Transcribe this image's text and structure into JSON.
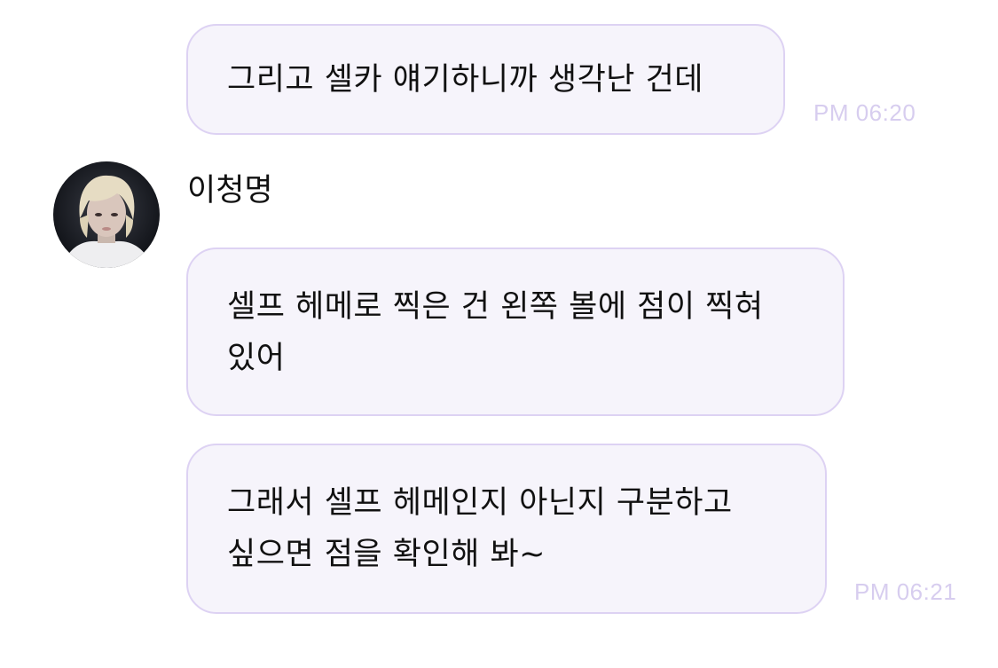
{
  "messages": [
    {
      "lines": [
        "그리고 셀카 얘기하니까 생각난 건데"
      ],
      "time": "PM 06:20"
    },
    {
      "lines": [
        "셀프 헤메로 찍은 건 왼쪽 볼에 점이 찍혀",
        "있어"
      ]
    },
    {
      "lines": [
        "그래서 셀프 헤메인지 아닌지 구분하고",
        "싶으면 점을 확인해 봐~"
      ],
      "time": "PM 06:21"
    }
  ],
  "sender": {
    "name": "이청명",
    "avatar_icon": "profile-photo-avatar"
  },
  "colors": {
    "bubble_background": "#f6f4fb",
    "bubble_border": "#ddd2f3",
    "timestamp": "#d7cdef"
  }
}
